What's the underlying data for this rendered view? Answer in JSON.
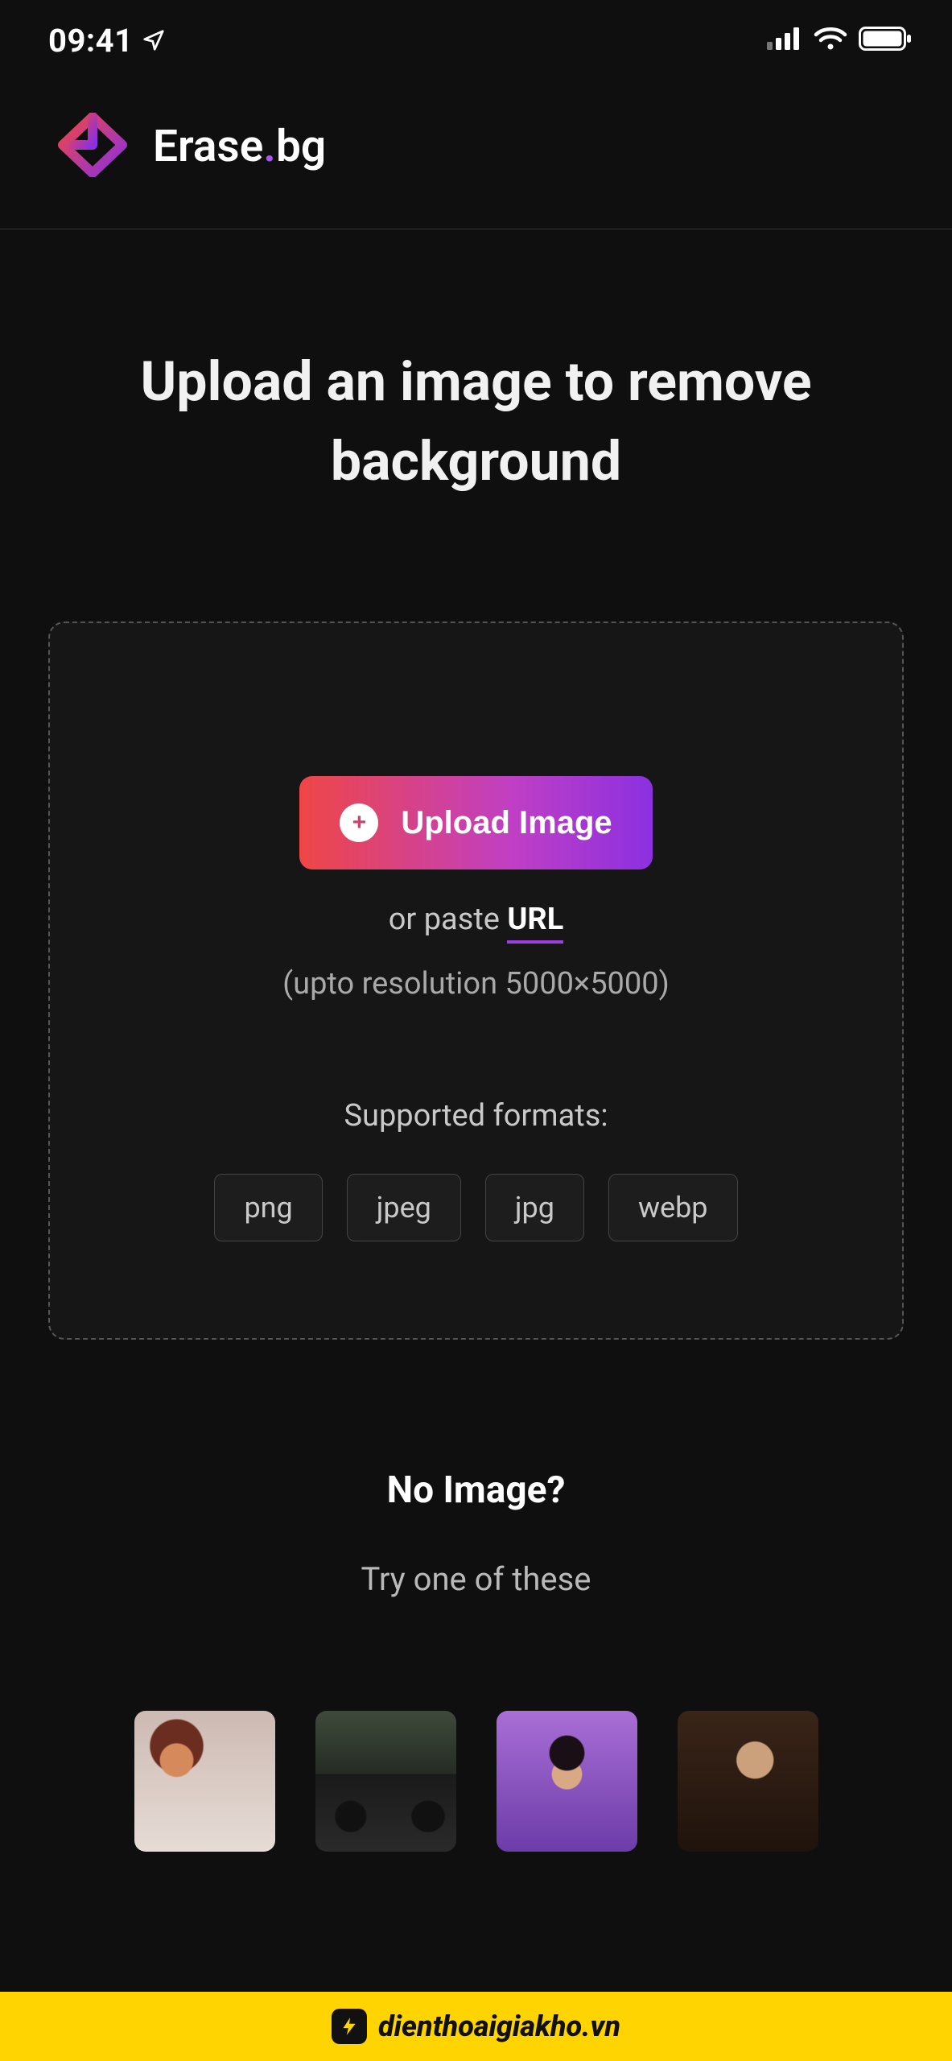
{
  "status": {
    "time": "09:41"
  },
  "brand": {
    "name_pre": "Erase",
    "name_post": "bg"
  },
  "page": {
    "title": "Upload an image to remove background"
  },
  "upload": {
    "button_label": "Upload Image",
    "paste_prefix": "or paste ",
    "paste_link": "URL",
    "resolution": "(upto resolution 5000×5000)",
    "supported_label": "Supported formats:",
    "formats": [
      "png",
      "jpeg",
      "jpg",
      "webp"
    ]
  },
  "noimage": {
    "title": "No Image?",
    "try": "Try one of these"
  },
  "samples": [
    {
      "name": "sample-woman-red-hair"
    },
    {
      "name": "sample-black-car"
    },
    {
      "name": "sample-woman-purple"
    },
    {
      "name": "sample-man-glasses"
    }
  ],
  "footer": {
    "text": "dienthoaigiakho.vn"
  }
}
